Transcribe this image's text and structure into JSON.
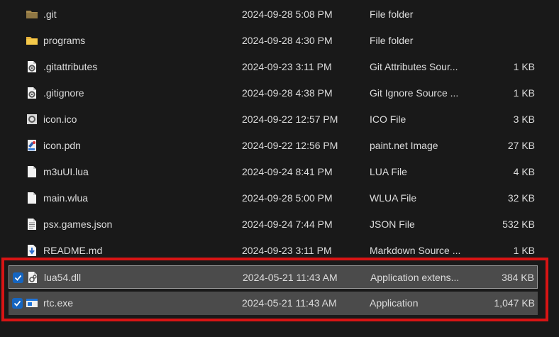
{
  "files": [
    {
      "name": ".git",
      "date": "2024-09-28 5:08 PM",
      "type": "File folder",
      "size": "",
      "icon": "folder-dim-icon"
    },
    {
      "name": "programs",
      "date": "2024-09-28 4:30 PM",
      "type": "File folder",
      "size": "",
      "icon": "folder-icon"
    },
    {
      "name": ".gitattributes",
      "date": "2024-09-23 3:11 PM",
      "type": "Git Attributes Sour...",
      "size": "1 KB",
      "icon": "settings-file-icon"
    },
    {
      "name": ".gitignore",
      "date": "2024-09-28 4:38 PM",
      "type": "Git Ignore Source ...",
      "size": "1 KB",
      "icon": "settings-file-icon"
    },
    {
      "name": "icon.ico",
      "date": "2024-09-22 12:57 PM",
      "type": "ICO File",
      "size": "3 KB",
      "icon": "ico-file-icon"
    },
    {
      "name": "icon.pdn",
      "date": "2024-09-22 12:56 PM",
      "type": "paint.net Image",
      "size": "27 KB",
      "icon": "paintnet-file-icon"
    },
    {
      "name": "m3uUI.lua",
      "date": "2024-09-24 8:41 PM",
      "type": "LUA File",
      "size": "4 KB",
      "icon": "blank-file-icon"
    },
    {
      "name": "main.wlua",
      "date": "2024-09-28 5:00 PM",
      "type": "WLUA File",
      "size": "32 KB",
      "icon": "blank-file-icon"
    },
    {
      "name": "psx.games.json",
      "date": "2024-09-24 7:44 PM",
      "type": "JSON File",
      "size": "532 KB",
      "icon": "text-file-icon"
    },
    {
      "name": "README.md",
      "date": "2024-09-23 3:11 PM",
      "type": "Markdown Source ...",
      "size": "1 KB",
      "icon": "markdown-file-icon"
    },
    {
      "name": "lua54.dll",
      "date": "2024-05-21 11:43 AM",
      "type": "Application extens...",
      "size": "384 KB",
      "icon": "dll-file-icon",
      "selected": true,
      "focused": true
    },
    {
      "name": "rtc.exe",
      "date": "2024-05-21 11:43 AM",
      "type": "Application",
      "size": "1,047 KB",
      "icon": "exe-file-icon",
      "selected": true
    }
  ],
  "colors": {
    "background": "#191919",
    "text": "#dcdcdc",
    "selection": "#4b4b4b",
    "checkbox": "#1565c0",
    "highlight_box": "#d81414"
  }
}
